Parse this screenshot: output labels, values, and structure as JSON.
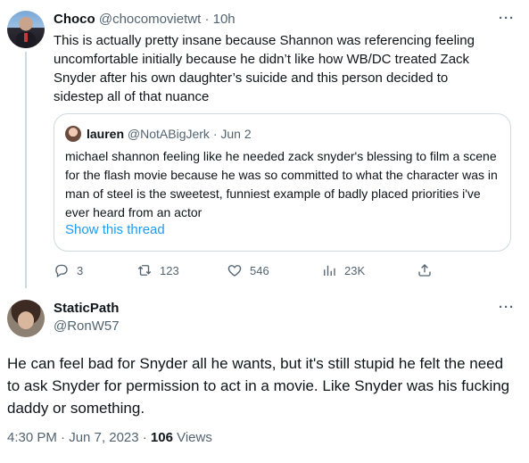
{
  "tweet1": {
    "display_name": "Choco",
    "handle": "@chocomovietwt",
    "separator": "·",
    "time": "10h",
    "more": "···",
    "text": "This is actually pretty insane because Shannon was referencing feeling uncomfortable initially because he didn’t like how WB/DC treated Zack Snyder after his own daughter’s suicide and this person decided to sidestep all of that nuance",
    "quoted": {
      "display_name": "lauren",
      "handle": "@NotABigJerk",
      "separator": "·",
      "date": "Jun 2",
      "text": "michael shannon feeling like he needed zack snyder's blessing to film a scene for the flash movie because he was so committed to what the character was in man of steel is the sweetest, funniest example of badly placed priorities i've ever heard from an actor",
      "link": "Show this thread"
    },
    "actions": {
      "replies": "3",
      "retweets": "123",
      "likes": "546",
      "views": "23K"
    }
  },
  "tweet2": {
    "display_name": "StaticPath",
    "handle": "@RonW57",
    "more": "···",
    "text": "He can feel bad for Snyder all he wants, but it's still stupid he felt the need to ask Snyder for permission to act in a movie. Like Snyder was his fucking daddy or something.",
    "timestamp": "4:30 PM · Jun 7, 2023 · ",
    "views_count": "106",
    "views_label": " Views"
  },
  "icons": {
    "reply": "reply-icon",
    "retweet": "retweet-icon",
    "like": "heart-icon",
    "views": "analytics-icon",
    "share": "share-icon"
  },
  "colors": {
    "link": "#1d9bf0",
    "muted": "#536471",
    "border": "#cfd9de"
  }
}
